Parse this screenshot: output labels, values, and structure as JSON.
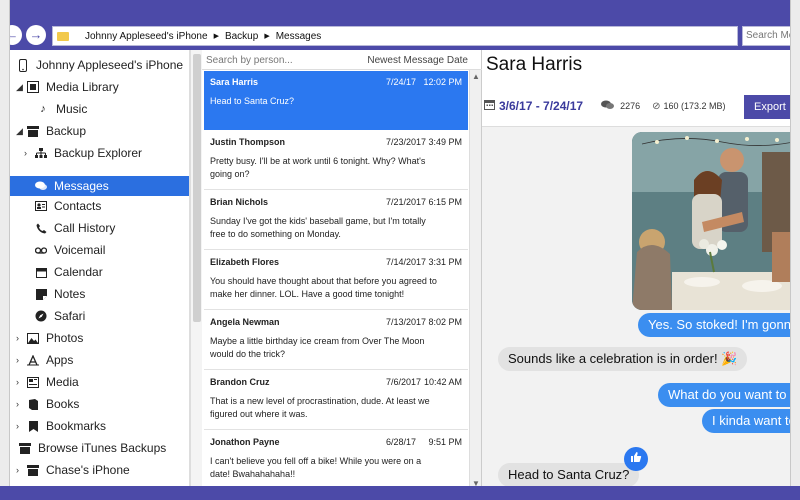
{
  "toolbar": {
    "back_icon": "arrow-left-icon",
    "forward_icon": "arrow-right-icon",
    "breadcrumb": [
      "Johnny Appleseed's iPhone",
      "Backup",
      "Messages"
    ],
    "search_placeholder": "Search Me"
  },
  "sidebar": {
    "items": [
      {
        "label": "Johnny Appleseed's iPhone",
        "icon": "phone-icon",
        "arrow": ""
      },
      {
        "label": "Media Library",
        "icon": "music-library-icon",
        "arrow": "◢"
      },
      {
        "label": "Music",
        "icon": "music-note-icon",
        "arrow": ""
      },
      {
        "label": "Backup",
        "icon": "backup-box-icon",
        "arrow": "◢"
      },
      {
        "label": "Backup Explorer",
        "icon": "sitemap-icon",
        "arrow": "›"
      },
      {
        "label": "Messages",
        "icon": "chat-icon",
        "arrow": ""
      },
      {
        "label": "Contacts",
        "icon": "contact-card-icon",
        "arrow": ""
      },
      {
        "label": "Call History",
        "icon": "phone-handset-icon",
        "arrow": ""
      },
      {
        "label": "Voicemail",
        "icon": "voicemail-icon",
        "arrow": ""
      },
      {
        "label": "Calendar",
        "icon": "calendar-icon",
        "arrow": ""
      },
      {
        "label": "Notes",
        "icon": "note-icon",
        "arrow": ""
      },
      {
        "label": "Safari",
        "icon": "compass-icon",
        "arrow": ""
      },
      {
        "label": "Photos",
        "icon": "photo-icon",
        "arrow": "›"
      },
      {
        "label": "Apps",
        "icon": "apps-icon",
        "arrow": "›"
      },
      {
        "label": "Media",
        "icon": "media-icon",
        "arrow": "›"
      },
      {
        "label": "Books",
        "icon": "book-icon",
        "arrow": "›"
      },
      {
        "label": "Bookmarks",
        "icon": "bookmark-icon",
        "arrow": "›"
      },
      {
        "label": "Browse iTunes Backups",
        "icon": "backup-box-icon",
        "arrow": ""
      },
      {
        "label": "Chase's iPhone",
        "icon": "backup-box-icon",
        "arrow": "›"
      }
    ]
  },
  "list": {
    "search_placeholder": "Search by person...",
    "sort_label": "Newest Message Date",
    "messages": [
      {
        "name": "Sara Harris",
        "date": "7/24/17",
        "time": "12:02 PM",
        "preview": "Head to Santa Cruz?"
      },
      {
        "name": "Justin Thompson",
        "date": "7/23/2017",
        "time": "3:49 PM",
        "preview": "Pretty busy. I'll be at work until 6 tonight. Why? What's going on?"
      },
      {
        "name": "Brian Nichols",
        "date": "7/21/2017",
        "time": "6:15 PM",
        "preview": "Sunday I've got the kids' baseball game, but I'm totally free to do something on Monday."
      },
      {
        "name": "Elizabeth Flores",
        "date": "7/14/2017",
        "time": "3:31 PM",
        "preview": "You should have thought about that before you agreed to make her dinner. LOL. Have a good time tonight!"
      },
      {
        "name": "Angela Newman",
        "date": "7/13/2017",
        "time": "8:02 PM",
        "preview": "Maybe a little birthday ice cream from Over The Moon would do the trick?"
      },
      {
        "name": "Brandon Cruz",
        "date": "7/6/2017",
        "time": "10:42 AM",
        "preview": "That is a new level of procrastination, dude. At least we figured out where it was."
      },
      {
        "name": "Jonathon Payne",
        "date": "6/28/17",
        "time": "9:51 PM",
        "preview": "I can't believe you fell off a bike! While you were on a date! Bwahahahaha!!"
      }
    ]
  },
  "conversation": {
    "title": "Sara Harris",
    "date_range": "3/6/17 - 7/24/17",
    "message_count": "2276",
    "attachments": "160 (173.2 MB)",
    "export_label": "Export",
    "bubbles": [
      {
        "text": "Yes. So stoked! I'm gonna b",
        "dir": "out"
      },
      {
        "text": "Sounds like a celebration is in order! 🎉",
        "dir": "in"
      },
      {
        "text": "What do you want to do",
        "dir": "out"
      },
      {
        "text": "I kinda want to g",
        "dir": "out"
      },
      {
        "text": "Head to Santa Cruz?",
        "dir": "in"
      }
    ]
  },
  "colors": {
    "accent": "#4c4aa8",
    "selection": "#2b78f0",
    "bubble_out": "#3b8ef0",
    "bubble_in": "#e2e2e2"
  }
}
